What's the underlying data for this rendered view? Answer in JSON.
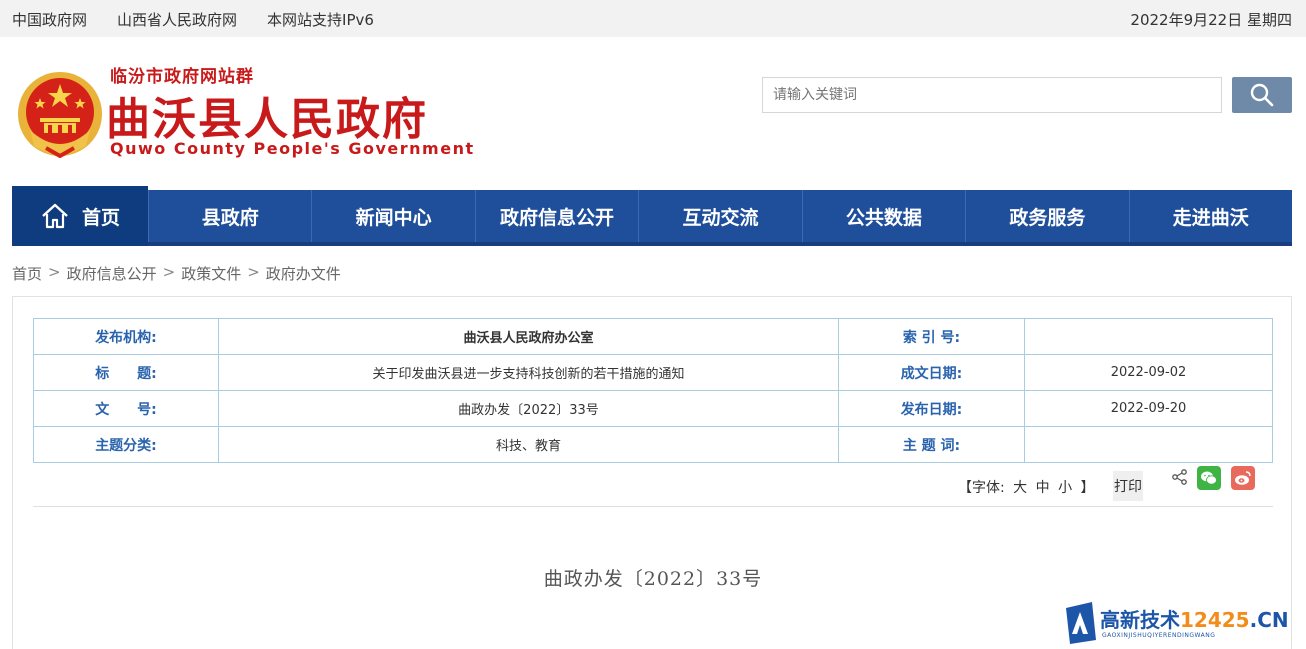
{
  "topbar": {
    "links": [
      "中国政府网",
      "山西省人民政府网",
      "本网站支持IPv6"
    ],
    "date": "2022年9月22日 星期四"
  },
  "header": {
    "site_group": "临汾市政府网站群",
    "title": "曲沃县人民政府",
    "title_en": "Quwo County People's Government",
    "search_placeholder": "请输入关键词"
  },
  "nav": {
    "home": "首页",
    "items": [
      "县政府",
      "新闻中心",
      "政府信息公开",
      "互动交流",
      "公共数据",
      "政务服务",
      "走进曲沃"
    ]
  },
  "breadcrumb": [
    "首页",
    "政府信息公开",
    "政策文件",
    "政府办文件"
  ],
  "info": {
    "rows": [
      {
        "label1": "发布机构:",
        "value1": "曲沃县人民政府办公室",
        "label2": "索 引 号:",
        "value2": ""
      },
      {
        "label1": "标　　题:",
        "value1": "关于印发曲沃县进一步支持科技创新的若干措施的通知",
        "label2": "成文日期:",
        "value2": "2022-09-02"
      },
      {
        "label1": "文　　号:",
        "value1": "曲政办发〔2022〕33号",
        "label2": "发布日期:",
        "value2": "2022-09-20"
      },
      {
        "label1": "主题分类:",
        "value1": "科技、教育",
        "label2": "主 题 词:",
        "value2": ""
      }
    ]
  },
  "tools": {
    "font_prefix": "【字体:",
    "large": "大",
    "medium": "中",
    "small": "小",
    "font_suffix": "】",
    "print": "打印"
  },
  "document": {
    "number": "曲政办发〔2022〕33号"
  },
  "watermark": {
    "text_main": "高新技术",
    "text_num": "12425",
    "text_domain": ".CN",
    "sub": "GAOXINJISHUQIYERENDINGWANG"
  },
  "colors": {
    "brand_red": "#c81a1a",
    "nav_blue": "#1f4f9a",
    "label_blue": "#2a63ad"
  }
}
